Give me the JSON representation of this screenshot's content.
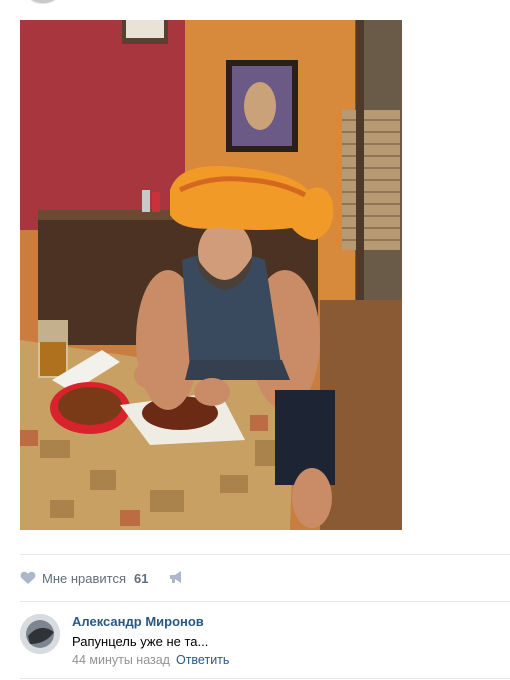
{
  "post": {
    "likes_label": "Мне нравится",
    "likes_count": "61"
  },
  "comment": {
    "author": "Александр Миронов",
    "text": "Рапунцель уже не та...",
    "time": "44 минуты назад",
    "reply_label": "Ответить"
  },
  "colors": {
    "link": "#2a5885",
    "muted": "#939393",
    "action": "#626d7a",
    "icon": "#aab8c8"
  }
}
